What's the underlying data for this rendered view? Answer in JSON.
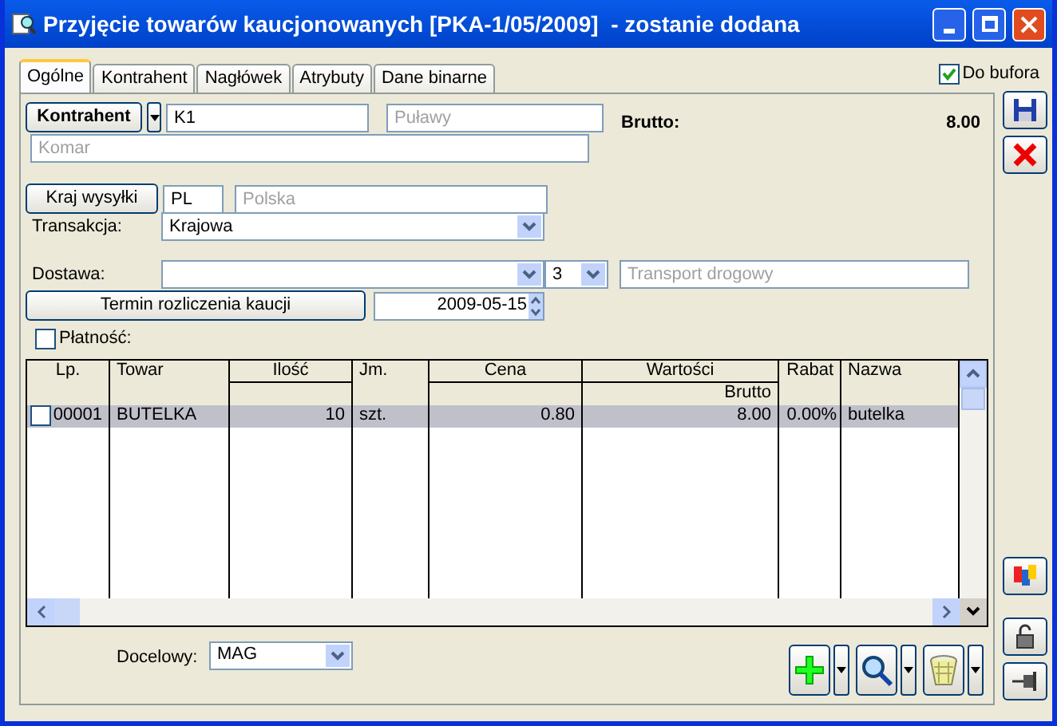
{
  "window": {
    "title": "Przyjęcie towarów kaucjonowanych [PKA-1/05/2009]  - zostanie dodana"
  },
  "buffer": {
    "label": "Do bufora",
    "checked": true
  },
  "tabs": [
    {
      "label": "Ogólne",
      "selected": true
    },
    {
      "label": "Kontrahent",
      "selected": false
    },
    {
      "label": "Nagłówek",
      "selected": false
    },
    {
      "label": "Atrybuty",
      "selected": false
    },
    {
      "label": "Dane binarne",
      "selected": false
    }
  ],
  "contractor": {
    "button": "Kontrahent",
    "code": "K1",
    "city": "Puławy",
    "name": "Komar"
  },
  "gross": {
    "label": "Brutto:",
    "value": "8.00"
  },
  "country": {
    "button": "Kraj wysyłki",
    "code": "PL",
    "name": "Polska"
  },
  "transaction": {
    "label": "Transakcja:",
    "value": "Krajowa"
  },
  "delivery": {
    "label": "Dostawa:",
    "code": "3",
    "name": "Transport drogowy"
  },
  "deposit_term": {
    "button": "Termin rozliczenia kaucji",
    "date": "2009-05-15"
  },
  "payment": {
    "label": "Płatność:",
    "checked": false
  },
  "table": {
    "columns": [
      {
        "label": "Lp.",
        "kind": "plain"
      },
      {
        "label": "Towar",
        "kind": "plain"
      },
      {
        "label": "Ilość",
        "kind": "split"
      },
      {
        "label": "Jm.",
        "kind": "plain"
      },
      {
        "label": "Cena",
        "kind": "split"
      },
      {
        "label": "Wartości",
        "kind": "split",
        "sublabel": "Brutto"
      },
      {
        "label": "Rabat",
        "kind": "plain"
      },
      {
        "label": "Nazwa",
        "kind": "plain"
      }
    ],
    "rows": [
      {
        "selected": true,
        "checked": false,
        "cells": [
          "00001",
          "BUTELKA",
          "10",
          "szt.",
          "0.80",
          "8.00",
          "0.00%",
          "butelka"
        ]
      }
    ]
  },
  "target": {
    "label": "Docelowy:",
    "value": "MAG"
  }
}
